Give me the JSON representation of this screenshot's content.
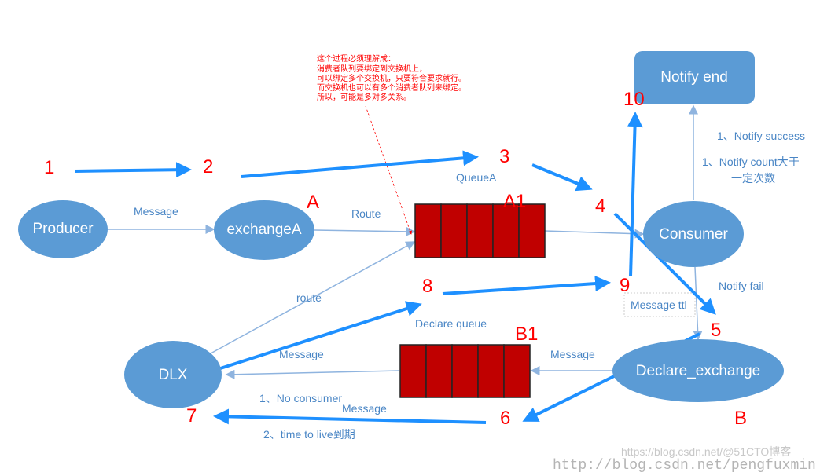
{
  "nodes": {
    "producer": "Producer",
    "exchangeA": "exchangeA",
    "consumer": "Consumer",
    "notify_end": "Notify end",
    "dlx": "DLX",
    "declare_exchange": "Declare_exchange"
  },
  "labels": {
    "message1": "Message",
    "route1": "Route",
    "queueA": "QueueA",
    "route2": "route",
    "declare_queue": "Declare queue",
    "message_dlx": "Message",
    "message_declare": "Message",
    "message_ttl": "Message ttl",
    "notify_fail": "Notify fail",
    "notify_success": "1、Notify success",
    "notify_count_1": "1、Notify count大于",
    "notify_count_2": "一定次数",
    "no_consumer": "1、No consumer",
    "message_bottom": "Message",
    "ttl_expire": "2、time to live到期"
  },
  "markers": {
    "n1": "1",
    "n2": "2",
    "n3": "3",
    "n4": "4",
    "n5": "5",
    "n6": "6",
    "n7": "7",
    "n8": "8",
    "n9": "9",
    "n10": "10",
    "A": "A",
    "A1": "A1",
    "B1": "B1",
    "B": "B"
  },
  "annotation": [
    "这个过程必须理解成：",
    "消费者队列要绑定到交换机上，",
    "可以绑定多个交换机，只要符合要求就行。",
    "而交换机也可以有多个消费者队列来绑定。",
    "所以，可能是多对多关系。"
  ],
  "watermark": {
    "line1": "https://blog.csdn.net/@51CTO博客",
    "line2": "http://blog.csdn.net/pengfuxmin"
  },
  "colors": {
    "node": "#5b9bd5",
    "queue": "#c00000",
    "arrow": "#1e90ff",
    "marker": "#ff0000"
  }
}
